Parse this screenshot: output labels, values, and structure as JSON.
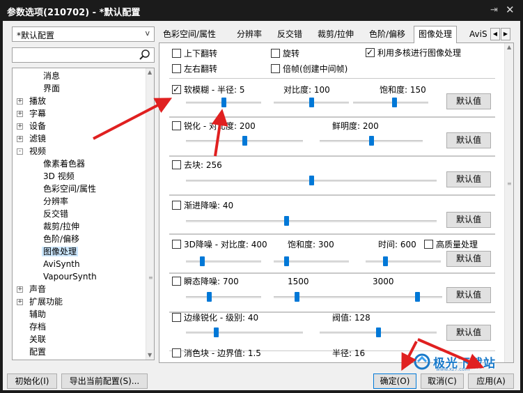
{
  "window": {
    "title": "参数选项(210702) - *默认配置"
  },
  "profile": {
    "selected": "*默认配置"
  },
  "search": {
    "placeholder": ""
  },
  "tree": {
    "items": [
      {
        "label": "消息",
        "level": 2,
        "expander": ""
      },
      {
        "label": "界面",
        "level": 2,
        "expander": ""
      },
      {
        "label": "播放",
        "level": 1,
        "expander": "+"
      },
      {
        "label": "字幕",
        "level": 1,
        "expander": "+"
      },
      {
        "label": "设备",
        "level": 1,
        "expander": "+"
      },
      {
        "label": "滤镜",
        "level": 1,
        "expander": "+"
      },
      {
        "label": "视频",
        "level": 1,
        "expander": "-"
      },
      {
        "label": "像素着色器",
        "level": 2,
        "expander": ""
      },
      {
        "label": "3D 视频",
        "level": 2,
        "expander": ""
      },
      {
        "label": "色彩空间/属性",
        "level": 2,
        "expander": ""
      },
      {
        "label": "分辨率",
        "level": 2,
        "expander": ""
      },
      {
        "label": "反交错",
        "level": 2,
        "expander": ""
      },
      {
        "label": "裁剪/拉伸",
        "level": 2,
        "expander": ""
      },
      {
        "label": "色阶/偏移",
        "level": 2,
        "expander": ""
      },
      {
        "label": "图像处理",
        "level": 2,
        "expander": "",
        "selected": true
      },
      {
        "label": "AviSynth",
        "level": 2,
        "expander": ""
      },
      {
        "label": "VapourSynth",
        "level": 2,
        "expander": ""
      },
      {
        "label": "声音",
        "level": 1,
        "expander": "+"
      },
      {
        "label": "扩展功能",
        "level": 1,
        "expander": "+"
      },
      {
        "label": "辅助",
        "level": 1,
        "expander": ""
      },
      {
        "label": "存档",
        "level": 1,
        "expander": ""
      },
      {
        "label": "关联",
        "level": 1,
        "expander": ""
      },
      {
        "label": "配置",
        "level": 1,
        "expander": ""
      }
    ]
  },
  "tabs": [
    {
      "label": "色彩空间/属性"
    },
    {
      "label": "分辨率"
    },
    {
      "label": "反交错"
    },
    {
      "label": "裁剪/拉伸"
    },
    {
      "label": "色阶/偏移"
    },
    {
      "label": "图像处理",
      "active": true
    },
    {
      "label": "AviS"
    }
  ],
  "options": {
    "flip_vertical": {
      "label": "上下翻转",
      "checked": false
    },
    "rotate": {
      "label": "旋转",
      "checked": false
    },
    "multicore": {
      "label": "利用多核进行图像处理",
      "checked": true
    },
    "flip_horizontal": {
      "label": "左右翻转",
      "checked": false
    },
    "double_frame": {
      "label": "倍帧(创建中间帧)",
      "checked": false
    }
  },
  "default_label": "默认值",
  "soft_blur": {
    "label": "软模糊 - 半径:  5",
    "checked": true,
    "contrast_label": "对比度:  100",
    "saturation_label": "饱和度:  150",
    "radius_pos": 0.5,
    "contrast_pos": 0.5,
    "saturation_pos": 0.55
  },
  "sharpen": {
    "label": "锐化 - 对比度:  200",
    "checked": false,
    "vividness_label": "鲜明度:  200",
    "contrast_pos": 0.5,
    "vividness_pos": 0.5
  },
  "deblock": {
    "label": "去块:  256",
    "checked": false,
    "pos": 0.5
  },
  "progressive_denoise": {
    "label": "渐进降噪:  40",
    "checked": false,
    "pos": 0.4
  },
  "denoise3d": {
    "label": "3D降噪 - 对比度:  400",
    "checked": false,
    "saturation_label": "饱和度:  300",
    "time_label": "时间:  600",
    "hq_label": "高质量处理",
    "hq_checked": false,
    "contrast_pos": 0.2,
    "saturation_pos": 0.15,
    "time_pos": 0.25
  },
  "transient_denoise": {
    "label": "瞬态降噪:  700",
    "checked": false,
    "value2": "1500",
    "value3": "3000",
    "pos1": 0.3,
    "pos2": 0.3,
    "pos3": 0.75
  },
  "edge_sharpen": {
    "label": "边缘锐化 - 级别:  40",
    "checked": false,
    "threshold_label": "阀值:  128",
    "level_pos": 0.25,
    "threshold_pos": 0.5
  },
  "dechroma": {
    "label": "消色块 - 边界值:  1.5",
    "checked": false,
    "radius_label": "半径:  16"
  },
  "footer": {
    "init": "初始化(I)",
    "export": "导出当前配置(S)...",
    "ok": "确定(O)",
    "cancel": "取消(C)",
    "apply": "应用(A)"
  },
  "watermark": {
    "text": "极光下载站",
    "url": "www.xz7.com"
  },
  "colors": {
    "accent": "#0078d7",
    "annotation_arrow": "#e02020",
    "title_bg": "#1b1b1b"
  },
  "icons": {
    "search": "magnifier-icon",
    "pin": "pin-icon",
    "close": "close-icon"
  }
}
